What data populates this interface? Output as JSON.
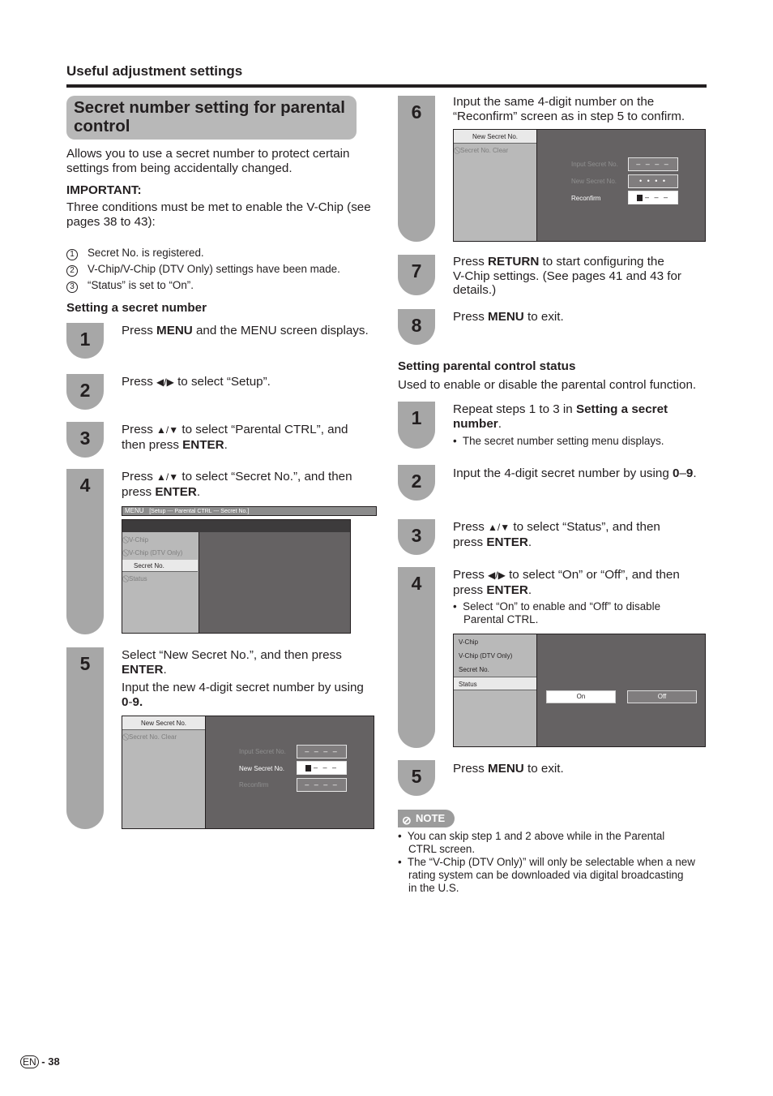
{
  "header": {
    "section_title": "Useful adjustment settings",
    "page_title_line1": "Secret number setting for parental",
    "page_title_line2": "control"
  },
  "intro": {
    "line1": "Allows you to use a secret number to protect certain",
    "line2": "settings from being accidentally changed.",
    "important_label": "IMPORTANT:",
    "conditions_line1": "Three conditions must be met to enable the V-Chip (see",
    "conditions_line2": "pages 38 to 43):",
    "conditions": [
      {
        "num": "1",
        "text": "Secret No. is registered."
      },
      {
        "num": "2",
        "text": "V-Chip/V-Chip (DTV Only) settings have been made."
      },
      {
        "num": "3",
        "text": "“Status” is set to “On”."
      }
    ]
  },
  "secret_section": {
    "heading": "Setting a secret number",
    "steps": [
      {
        "num": "1",
        "pre": "Press ",
        "bold": "MENU",
        "post": " and the MENU screen displays."
      },
      {
        "num": "2",
        "pre": "Press ",
        "arrows": "◀/▶",
        "post": " to select “Setup”."
      },
      {
        "num": "3",
        "pre": "Press ",
        "arrows": "▲/▼",
        "post": " to select “Parental CTRL”, and",
        "line2_pre": "then press ",
        "line2_bold": "ENTER",
        "line2_post": "."
      },
      {
        "num": "4",
        "pre": "Press ",
        "arrows": "▲/▼",
        "post": " to select “Secret No.”, and then",
        "line2_pre": "press  ",
        "line2_bold": "ENTER",
        "line2_post": "."
      },
      {
        "num": "5",
        "line1": "Select “New Secret No.”, and then press",
        "line1b_bold": "ENTER",
        "line1b_post": ".",
        "line2": "Input the new 4-digit secret number by using",
        "line2b_bold": "0",
        "line2b_mid": "-",
        "line2b_bold2": "9."
      }
    ],
    "menu_screen": {
      "breadcrumb_menu": "MENU",
      "breadcrumb_path": "[Setup --- Parental CTRL --- Secret No.]",
      "items": [
        {
          "label": "V-Chip",
          "state": "disabled"
        },
        {
          "label": "V-Chip (DTV Only)",
          "state": "disabled"
        },
        {
          "label": "Secret No.",
          "state": "selected"
        },
        {
          "label": "Status",
          "state": "disabled"
        }
      ]
    },
    "input_screen": {
      "tabs": [
        {
          "label": "New Secret No.",
          "state": "selected"
        },
        {
          "label": "Secret No. Clear",
          "state": "disabled"
        }
      ],
      "fields": [
        {
          "label": "Input Secret No.",
          "value": "– – – –",
          "active": false
        },
        {
          "label": "New Secret No.",
          "value": "– – –",
          "active": true
        },
        {
          "label": "Reconfirm",
          "value": "– – – –",
          "active": false
        }
      ]
    }
  },
  "right_steps": {
    "step6": {
      "num": "6",
      "line1": "Input the same 4-digit number on the",
      "line2": "“Reconfirm” screen as in step 5 to confirm."
    },
    "reconfirm_screen": {
      "tabs": [
        {
          "label": "New Secret No.",
          "state": "selected"
        },
        {
          "label": "Secret No. Clear",
          "state": "disabled"
        }
      ],
      "fields": [
        {
          "label": "Input Secret No.",
          "value": "– – – –",
          "active": false
        },
        {
          "label": "New Secret No.",
          "value": "• • • •",
          "active": false
        },
        {
          "label": "Reconfirm",
          "value": "– – –",
          "active": true
        }
      ]
    },
    "step7": {
      "num": "7",
      "pre": "Press ",
      "bold": "RETURN",
      "post": " to start configuring the",
      "line2": "V-Chip settings. (See pages 41 and 43 for",
      "line3": "details.)"
    },
    "step8": {
      "num": "8",
      "pre": "Press ",
      "bold": "MENU",
      "post": " to exit."
    }
  },
  "status_section": {
    "heading": "Setting parental control status",
    "description": "Used to enable or disable the parental control function.",
    "steps": [
      {
        "num": "1",
        "pre": "Repeat steps 1 to 3 in ",
        "bold": "Setting a secret",
        "line2_bold": "number",
        "line2_post": ".",
        "bullet": "The secret number setting menu displays."
      },
      {
        "num": "2",
        "pre": "Input the 4-digit secret number by using ",
        "bold": "0",
        "mid": "–",
        "bold2": "9",
        "post": "."
      },
      {
        "num": "3",
        "pre": "Press ",
        "arrows": "▲/▼",
        "post": " to select “Status”, and then",
        "line2_pre": "press ",
        "line2_bold": "ENTER",
        "line2_post": "."
      },
      {
        "num": "4",
        "pre": "Press ",
        "arrows": "◀/▶",
        "post": " to select “On” or “Off”, and then",
        "line2_pre": "press ",
        "line2_bold": "ENTER",
        "line2_post": ".",
        "bullet_line1": "Select “On” to enable and “Off” to disable",
        "bullet_line2": "Parental CTRL."
      },
      {
        "num": "5",
        "pre": "Press ",
        "bold": "MENU",
        "post": " to exit."
      }
    ],
    "status_screen": {
      "items": [
        {
          "label": "V-Chip",
          "state": "normal"
        },
        {
          "label": "V-Chip (DTV Only)",
          "state": "normal"
        },
        {
          "label": "Secret No.",
          "state": "normal"
        },
        {
          "label": "Status",
          "state": "selected"
        }
      ],
      "options": [
        {
          "label": "On",
          "selected": true
        },
        {
          "label": "Off",
          "selected": false
        }
      ]
    }
  },
  "note": {
    "badge": "NOTE",
    "items": [
      {
        "line1": "You can skip step 1 and 2 above while in the Parental",
        "line2": "CTRL screen."
      },
      {
        "line1": "The “V-Chip (DTV Only)” will only be selectable when a new",
        "line2": "rating system can be downloaded via digital broadcasting",
        "line3": "in the U.S."
      }
    ]
  },
  "footer": {
    "lang_badge": "EN",
    "page_number": "- 38"
  }
}
